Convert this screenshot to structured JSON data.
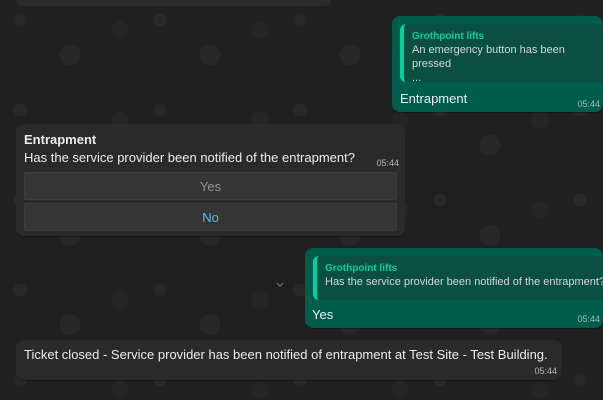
{
  "messages": {
    "m1": {
      "quote_sender": "Grothpoint lifts",
      "quote_text": "An emergency button has been pressed\n...",
      "text": "Entrapment",
      "time": "05:44"
    },
    "m2": {
      "title": "Entrapment",
      "body": "Has the service provider been notified of the entrapment?",
      "time": "05:44",
      "buttons": {
        "yes": "Yes",
        "no": "No"
      }
    },
    "m3": {
      "quote_sender": "Grothpoint lifts",
      "quote_text": "Has the service provider been notified of the entrapment?",
      "text": "Yes",
      "time": "05:44"
    },
    "m4": {
      "text": "Ticket closed - Service provider has been notified of entrapment at Test Site - Test Building.",
      "time": "05:44"
    }
  },
  "icons": {
    "scroll_chevron": "chevron-down-icon"
  },
  "colors": {
    "outgoing_bubble": "#005c4b",
    "incoming_bubble": "#2a2a2a",
    "quote_accent": "#06cf9c",
    "link_blue": "#53bdeb"
  }
}
